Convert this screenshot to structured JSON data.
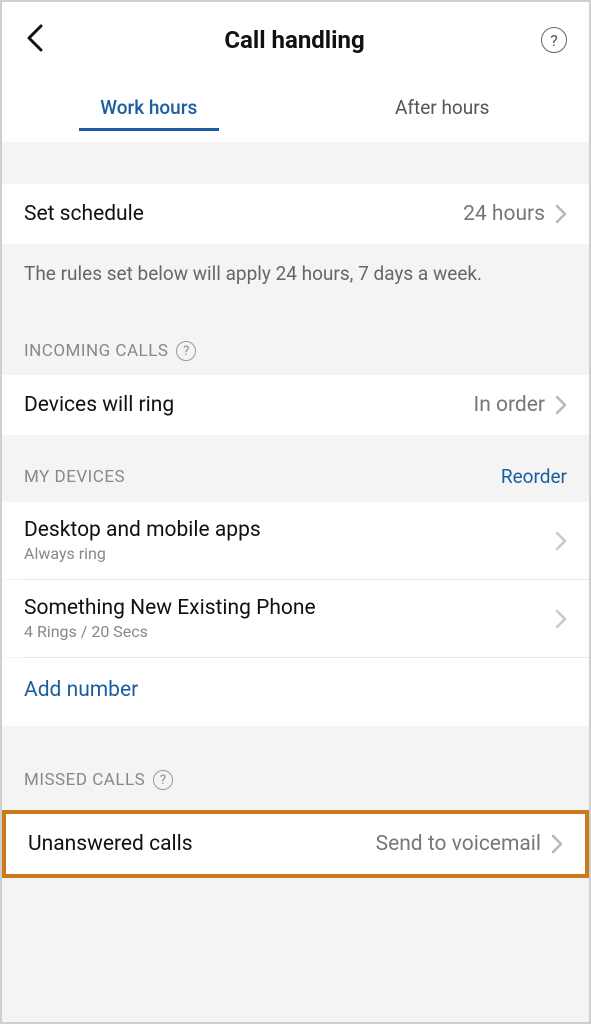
{
  "header": {
    "title": "Call handling"
  },
  "tabs": {
    "work": "Work hours",
    "after": "After hours"
  },
  "schedule": {
    "label": "Set schedule",
    "value": "24 hours",
    "info": "The rules set below will apply 24 hours, 7 days a week."
  },
  "incoming": {
    "caption": "INCOMING CALLS",
    "row_label": "Devices will ring",
    "row_value": "In order"
  },
  "devices": {
    "caption": "MY DEVICES",
    "reorder": "Reorder",
    "items": [
      {
        "name": "Desktop and mobile apps",
        "detail": "Always ring"
      },
      {
        "name": "Something New Existing Phone",
        "detail": "4 Rings / 20 Secs"
      }
    ],
    "add": "Add number"
  },
  "missed": {
    "caption": "MISSED CALLS",
    "row_label": "Unanswered calls",
    "row_value": "Send to voicemail"
  }
}
